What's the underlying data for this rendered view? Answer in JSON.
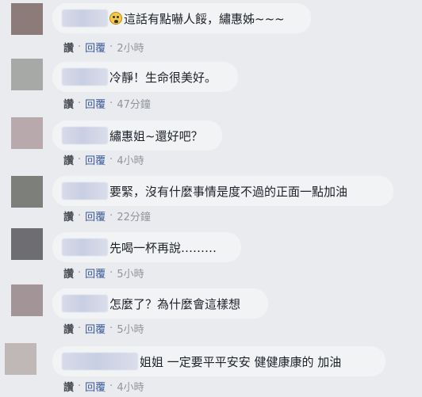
{
  "actions": {
    "like": "讚",
    "reply": "回覆",
    "separator": "·"
  },
  "comments": [
    {
      "text": "這話有點嚇人餒，繡惠姊~~~",
      "time": "2小時",
      "emoji": "fearful-face"
    },
    {
      "text": "冷靜！生命很美好。",
      "time": "47分鐘"
    },
    {
      "text": "繡惠姐~還好吧？",
      "time": "4小時"
    },
    {
      "text": "要緊，沒有什麼事情是度不過的正面一點加油",
      "time": "22分鐘"
    },
    {
      "text": "先喝一杯再說………",
      "time": "5小時"
    },
    {
      "text": "怎麼了？為什麼會這樣想",
      "time": "5小時"
    },
    {
      "text": "姐姐 一定要平平安安 健健康康的 加油",
      "time": "4小時"
    }
  ],
  "colors": {
    "background": "#e9ebee",
    "bubble": "#f2f3f5",
    "link": "#385898",
    "meta": "#90949c",
    "avatars": [
      "#8c7b78",
      "#a7a9a6",
      "#b8a9ad",
      "#7d7f7a",
      "#6e6d72",
      "#a29497",
      "#c0b8b6"
    ]
  }
}
